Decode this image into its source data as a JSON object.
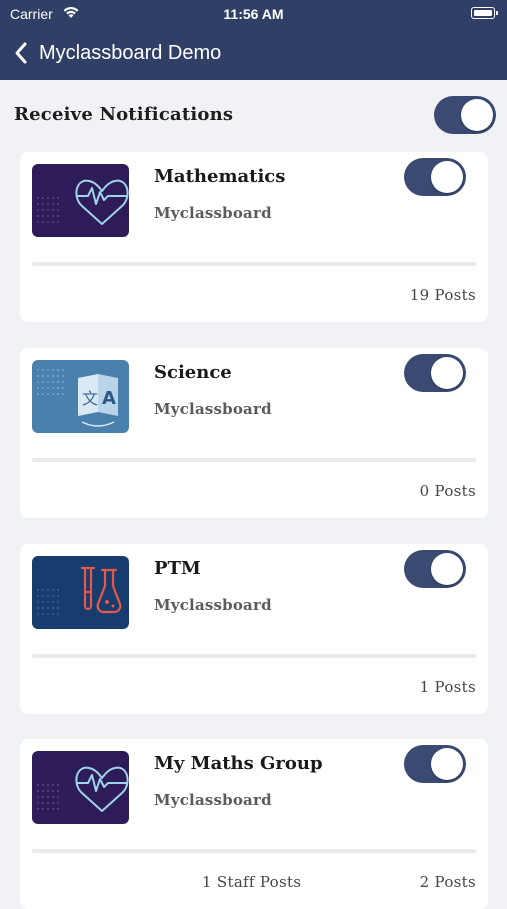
{
  "status_bar": {
    "carrier": "Carrier",
    "time": "11:56 AM"
  },
  "nav": {
    "title": "Myclassboard Demo",
    "back_icon": "chevron-left-icon"
  },
  "notifications": {
    "label": "Receive Notifications",
    "enabled": true
  },
  "colors": {
    "accent": "#2f3f66",
    "toggle_on": "#3a4a72",
    "background": "#f1f2f6"
  },
  "courses": [
    {
      "name": "Mathematics",
      "org": "Myclassboard",
      "posts": "19 Posts",
      "staff_posts": "",
      "enabled": true,
      "icon": "heart-pulse-icon"
    },
    {
      "name": "Science",
      "org": "Myclassboard",
      "posts": "0 Posts",
      "staff_posts": "",
      "enabled": true,
      "icon": "translate-book-icon"
    },
    {
      "name": "PTM",
      "org": "Myclassboard",
      "posts": "1 Posts",
      "staff_posts": "",
      "enabled": true,
      "icon": "lab-flask-icon"
    },
    {
      "name": "My Maths Group",
      "org": "Myclassboard",
      "posts": "2 Posts",
      "staff_posts": "1 Staff Posts",
      "enabled": true,
      "icon": "heart-pulse-icon"
    }
  ]
}
